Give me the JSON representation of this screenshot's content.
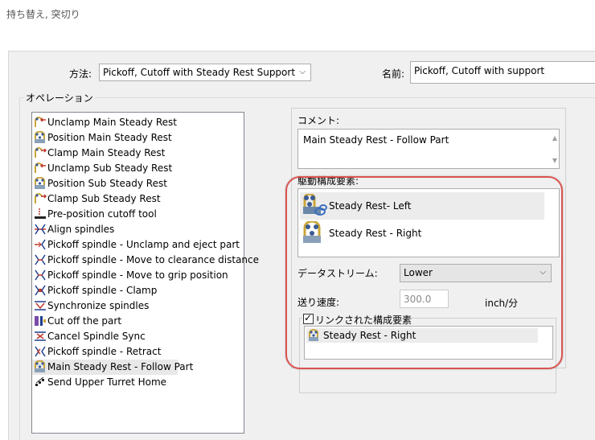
{
  "window": {
    "title": "持ち替え, 突切り"
  },
  "method": {
    "label": "方法:",
    "value": "Pickoff, Cutoff with Steady Rest Support"
  },
  "name_field": {
    "label": "名前:",
    "value": "Pickoff, Cutoff with support"
  },
  "operations": {
    "label": "オペレーション",
    "items": [
      {
        "label": "Unclamp Main Steady Rest",
        "icon": "steady-rest-unclamp-icon"
      },
      {
        "label": "Position Main Steady Rest",
        "icon": "steady-rest-position-icon"
      },
      {
        "label": "Clamp Main Steady Rest",
        "icon": "steady-rest-clamp-icon"
      },
      {
        "label": "Unclamp Sub Steady Rest",
        "icon": "steady-rest-unclamp-icon"
      },
      {
        "label": "Position Sub Steady Rest",
        "icon": "steady-rest-position-icon"
      },
      {
        "label": "Clamp Sub Steady Rest",
        "icon": "steady-rest-clamp-icon"
      },
      {
        "label": "Pre-position cutoff tool",
        "icon": "cutoff-tool-icon"
      },
      {
        "label": "Align spindles",
        "icon": "align-spindles-icon"
      },
      {
        "label": "Pickoff spindle - Unclamp and eject part",
        "icon": "pickoff-eject-icon"
      },
      {
        "label": "Pickoff spindle - Move to clearance distance",
        "icon": "pickoff-move-icon"
      },
      {
        "label": "Pickoff spindle - Move to grip position",
        "icon": "pickoff-move-icon"
      },
      {
        "label": "Pickoff spindle - Clamp",
        "icon": "pickoff-clamp-icon"
      },
      {
        "label": "Synchronize spindles",
        "icon": "sync-spindles-icon"
      },
      {
        "label": "Cut off the part",
        "icon": "cut-off-icon"
      },
      {
        "label": "Cancel Spindle Sync",
        "icon": "cancel-sync-icon"
      },
      {
        "label": "Pickoff spindle - Retract",
        "icon": "pickoff-retract-icon"
      },
      {
        "label": "Main Steady Rest - Follow Part",
        "icon": "steady-rest-follow-icon"
      },
      {
        "label": "Send Upper Turret Home",
        "icon": "turret-home-icon"
      }
    ],
    "selected_index": 16
  },
  "comment": {
    "label": "コメント:",
    "value": "Main Steady Rest - Follow Part"
  },
  "drive_components": {
    "label": "駆動構成要素:",
    "items": [
      {
        "label": "Steady Rest- Left",
        "icon": "steady-rest-linked-icon"
      },
      {
        "label": "Steady Rest - Right",
        "icon": "steady-rest-icon"
      }
    ]
  },
  "datastream": {
    "label": "データストリーム:",
    "value": "Lower"
  },
  "feed_rate": {
    "label": "送り速度:",
    "value": "300.0",
    "unit": "inch/分"
  },
  "linked_components": {
    "label": "リンクされた構成要素",
    "checked": true,
    "items": [
      {
        "label": "Steady Rest - Right",
        "icon": "steady-rest-small-icon"
      }
    ]
  },
  "colors": {
    "highlight_outline": "#d9534f",
    "panel_bg": "#f0f0f0"
  }
}
